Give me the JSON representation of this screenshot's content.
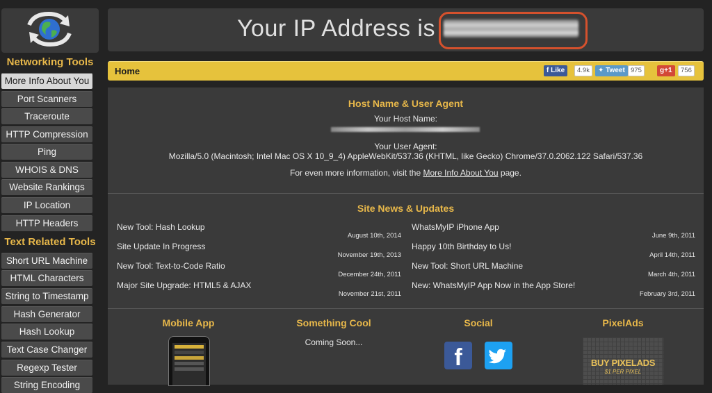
{
  "header": {
    "ip_label": "Your IP Address is"
  },
  "sidebar": {
    "networking_title": "Networking Tools",
    "networking_items": [
      {
        "label": "More Info About You"
      },
      {
        "label": "Port Scanners"
      },
      {
        "label": "Traceroute"
      },
      {
        "label": "HTTP Compression"
      },
      {
        "label": "Ping"
      },
      {
        "label": "WHOIS & DNS"
      },
      {
        "label": "Website Rankings"
      },
      {
        "label": "IP Location"
      },
      {
        "label": "HTTP Headers"
      }
    ],
    "text_title": "Text Related Tools",
    "text_items": [
      {
        "label": "Short URL Machine"
      },
      {
        "label": "HTML Characters"
      },
      {
        "label": "String to Timestamp"
      },
      {
        "label": "Hash Generator"
      },
      {
        "label": "Hash Lookup"
      },
      {
        "label": "Text Case Changer"
      },
      {
        "label": "Regexp Tester"
      },
      {
        "label": "String Encoding"
      }
    ]
  },
  "homebar": {
    "label": "Home",
    "facebook_label": "Like",
    "facebook_count": "4.9k",
    "twitter_label": "Tweet",
    "twitter_count": "975",
    "gplus_label": "+1",
    "gplus_count": "756"
  },
  "host": {
    "title": "Host Name & User Agent",
    "host_label": "Your Host Name:",
    "agent_label": "Your User Agent:",
    "user_agent": "Mozilla/5.0 (Macintosh; Intel Mac OS X 10_9_4) AppleWebKit/537.36 (KHTML, like Gecko) Chrome/37.0.2062.122 Safari/537.36",
    "more_prefix": "For even more information, visit the",
    "more_link": "More Info About You",
    "more_suffix": "page."
  },
  "news": {
    "title": "Site News & Updates",
    "left": [
      {
        "title": "New Tool: Hash Lookup",
        "date": "August 10th, 2014"
      },
      {
        "title": "Site Update In Progress",
        "date": "November 19th, 2013"
      },
      {
        "title": "New Tool: Text-to-Code Ratio",
        "date": "December 24th, 2011"
      },
      {
        "title": "Major Site Upgrade: HTML5 & AJAX",
        "date": "November 21st, 2011"
      }
    ],
    "right": [
      {
        "title": "WhatsMyIP iPhone App",
        "date": "June 9th, 2011"
      },
      {
        "title": "Happy 10th Birthday to Us!",
        "date": "April 14th, 2011"
      },
      {
        "title": "New Tool: Short URL Machine",
        "date": "March 4th, 2011"
      },
      {
        "title": "New: WhatsMyIP App Now in the App Store!",
        "date": "February 3rd, 2011"
      }
    ]
  },
  "footer": {
    "mobile_title": "Mobile App",
    "cool_title": "Something Cool",
    "cool_text": "Coming Soon...",
    "social_title": "Social",
    "pixelads_title": "PixelAds",
    "pixelads_line1": "BUY PIXELADS",
    "pixelads_line2": "$1 PER PIXEL"
  },
  "colors": {
    "accent": "#e8b84a",
    "home_bar": "#e6c23c",
    "ip_ring": "#d5512d",
    "background": "#232323",
    "panel": "#3a3a3a"
  }
}
